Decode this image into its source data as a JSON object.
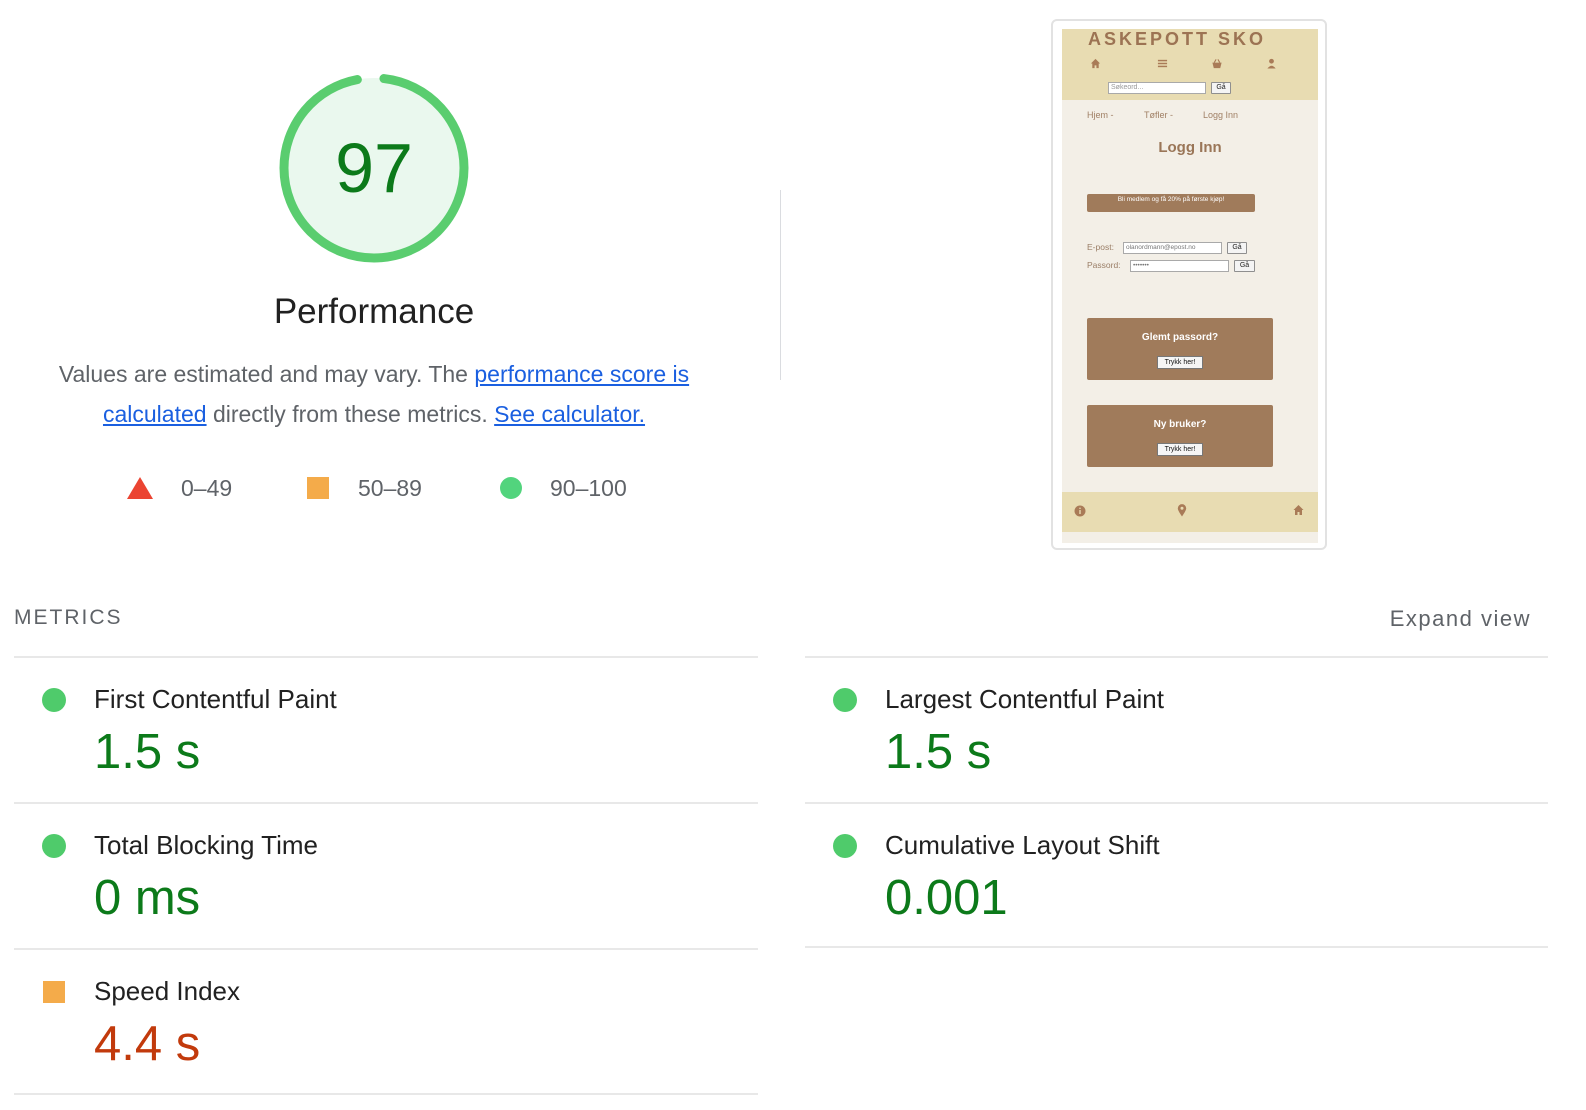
{
  "score": {
    "value": "97",
    "fraction": 0.97,
    "title": "Performance",
    "color": "#0c7a1a",
    "ring_color": "#5acd6f",
    "fill_color": "#eaf8ee"
  },
  "description": {
    "text_before": "Values are estimated and may vary. The ",
    "link_score": "performance score is calculated",
    "text_middle": " directly from these metrics. ",
    "link_calculator": "See calculator."
  },
  "legend": [
    {
      "shape": "triangle-icon",
      "range": "0–49",
      "color": "#eb4432"
    },
    {
      "shape": "square-icon",
      "range": "50–89",
      "color": "#f4ab4a"
    },
    {
      "shape": "circle-icon",
      "range": "90–100",
      "color": "#18c551"
    }
  ],
  "screenshot": {
    "brand": "ASKEPOTT SKO",
    "nav_icons": [
      "home-icon",
      "menu-icon",
      "basket-icon",
      "user-icon"
    ],
    "search_placeholder": "Søkeord...",
    "search_button": "Gå",
    "breadcrumbs": [
      "Hjem -",
      "Tøfler -",
      "Logg Inn"
    ],
    "page_title": "Logg Inn",
    "banner": "Bli medlem og få 20% på første kjøp!",
    "email_label": "E-post:",
    "email_value": "olanordmann@epost.no",
    "email_button": "Gå",
    "password_label": "Passord:",
    "password_value": "•••••••",
    "password_button": "Gå",
    "forgot_title": "Glemt passord?",
    "forgot_button": "Trykk her!",
    "new_user_title": "Ny bruker?",
    "new_user_button": "Trykk her!",
    "footer_icons": [
      "info-icon",
      "location-pin-icon",
      "home-icon"
    ]
  },
  "metrics_section": {
    "header": "METRICS",
    "expand": "Expand view"
  },
  "metrics": [
    {
      "title": "First Contentful Paint",
      "value": "1.5 s",
      "rating": "good"
    },
    {
      "title": "Largest Contentful Paint",
      "value": "1.5 s",
      "rating": "good"
    },
    {
      "title": "Total Blocking Time",
      "value": "0 ms",
      "rating": "good"
    },
    {
      "title": "Cumulative Layout Shift",
      "value": "0.001",
      "rating": "good"
    },
    {
      "title": "Speed Index",
      "value": "4.4 s",
      "rating": "average"
    }
  ]
}
